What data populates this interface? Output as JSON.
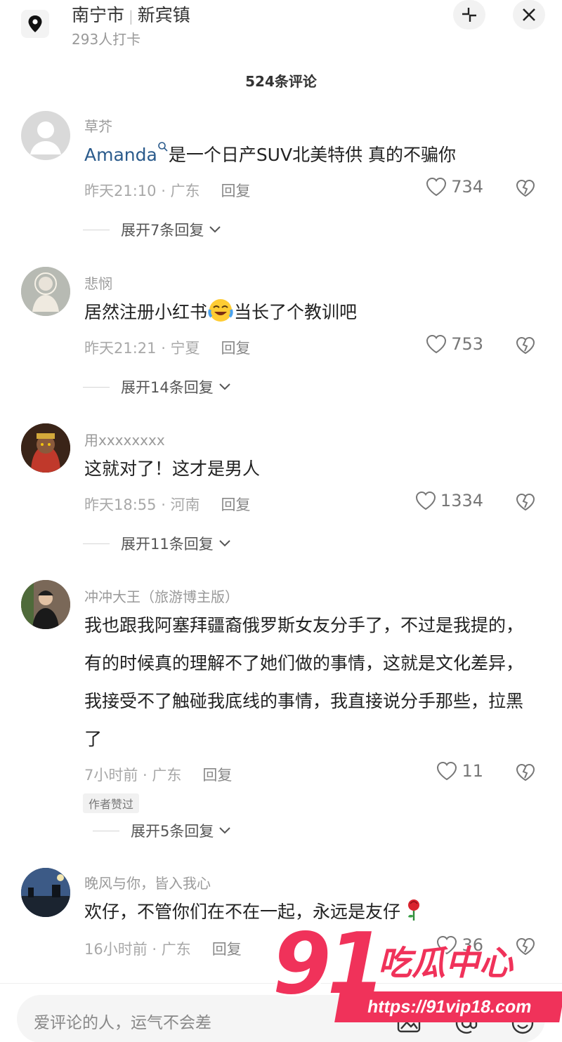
{
  "header": {
    "city": "南宁市",
    "town": "新宾镇",
    "checkins": "293人打卡",
    "collapse_icon": "collapse-icon",
    "close_icon": "close-icon"
  },
  "comment_count": "524条评论",
  "comments": [
    {
      "user": "草芥",
      "mention": "Amanda",
      "text": "是一个日产SUV北美特供 真的不骗你",
      "meta": "昨天21:10 · 广东",
      "reply": "回复",
      "likes": "734",
      "expand": "展开7条回复"
    },
    {
      "user": "悲悯",
      "text_before": "居然注册小红书",
      "text_after": "当长了个教训吧",
      "meta": "昨天21:21 · 宁夏",
      "reply": "回复",
      "likes": "753",
      "expand": "展开14条回复"
    },
    {
      "user": "用xxxxxxxx",
      "text": "这就对了！这才是男人",
      "meta": "昨天18:55 · 河南",
      "reply": "回复",
      "likes": "1334",
      "expand": "展开11条回复"
    },
    {
      "user": "冲冲大王（旅游博主版）",
      "text": "我也跟我阿塞拜疆裔俄罗斯女友分手了，不过是我提的，有的时候真的理解不了她们做的事情，这就是文化差异，我接受不了触碰我底线的事情，我直接说分手那些，拉黑了",
      "meta": "7小时前 · 广东",
      "reply": "回复",
      "likes": "11",
      "badge": "作者赞过",
      "expand": "展开5条回复"
    },
    {
      "user": "晚风与你，皆入我心",
      "text": "欢仔，不管你们在不在一起，永远是友仔",
      "meta": "16小时前 · 广东",
      "reply": "回复",
      "likes": "36"
    }
  ],
  "input": {
    "placeholder": "爱评论的人，运气不会差"
  },
  "watermark": {
    "number": "91",
    "title": "吃瓜中心",
    "url": "https://91vip18.com"
  },
  "colors": {
    "mention": "#2b5b8c",
    "watermark": "#f0325a"
  }
}
